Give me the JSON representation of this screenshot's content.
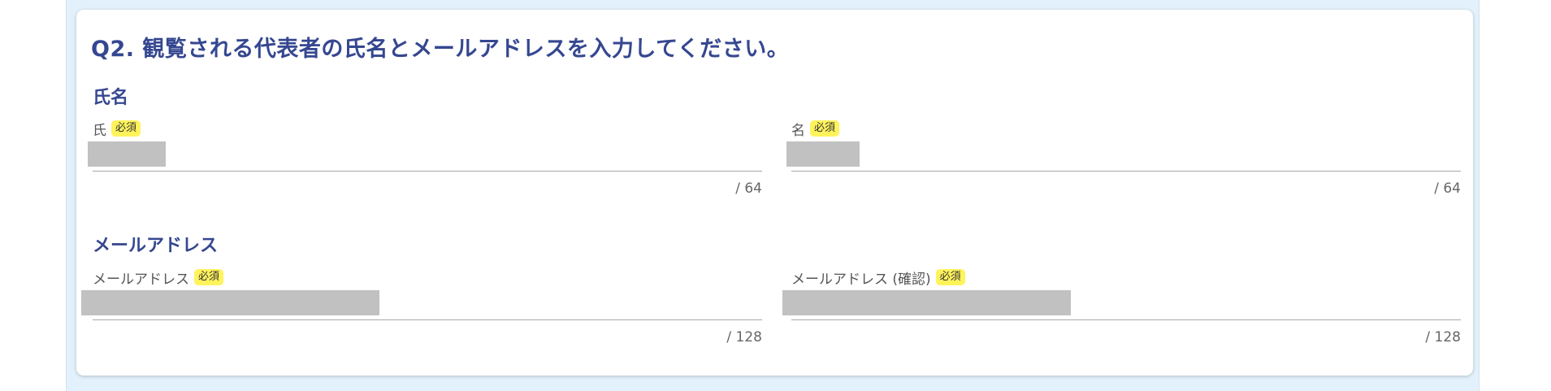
{
  "question": {
    "title": "Q2. 観覧される代表者の氏名とメールアドレスを入力してください。"
  },
  "sections": {
    "name": {
      "label": "氏名",
      "fields": [
        {
          "label": "氏",
          "required_badge": "必須",
          "value": "",
          "counter": "/ 64"
        },
        {
          "label": "名",
          "required_badge": "必須",
          "value": "",
          "counter": "/ 64"
        }
      ]
    },
    "email": {
      "label": "メールアドレス",
      "fields": [
        {
          "label": "メールアドレス",
          "required_badge": "必須",
          "value": "",
          "counter": "/ 128"
        },
        {
          "label": "メールアドレス (確認)",
          "required_badge": "必須",
          "value": "",
          "counter": "/ 128"
        }
      ]
    }
  },
  "colors": {
    "background": "#e2f1fb",
    "card": "#ffffff",
    "heading": "#354790",
    "required_badge": "#fff35c",
    "redacted_value": "#c1c1c1",
    "underline": "#a8a8a8"
  }
}
